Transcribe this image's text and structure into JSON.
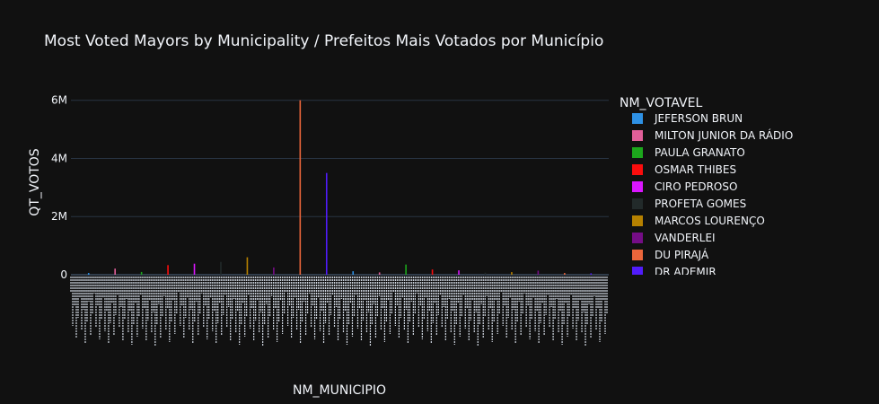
{
  "chart_data": {
    "type": "bar",
    "title": "Most Voted Mayors by Municipality / Prefeitos Mais Votados por Município",
    "xlabel": "NM_MUNICIPIO",
    "ylabel": "QT_VOTOS",
    "ylim": [
      0,
      6300000
    ],
    "yticks": [
      {
        "value": 0,
        "label": "0"
      },
      {
        "value": 2000000,
        "label": "2M"
      },
      {
        "value": 4000000,
        "label": "4M"
      },
      {
        "value": 6000000,
        "label": "6M"
      }
    ],
    "legend": {
      "title": "NM_VOTAVEL",
      "placement": "right",
      "items": [
        {
          "name": "JEFERSON BRUN",
          "color": "#2E91E5"
        },
        {
          "name": "MILTON JUNIOR DA RÁDIO",
          "color": "#E15F99"
        },
        {
          "name": "PAULA GRANATO",
          "color": "#1CA71C"
        },
        {
          "name": "OSMAR THIBES",
          "color": "#FB0D0D"
        },
        {
          "name": "CIRO PEDROSO",
          "color": "#DA16FF"
        },
        {
          "name": "PROFETA GOMES",
          "color": "#222A2A"
        },
        {
          "name": "MARCOS LOURENÇO",
          "color": "#B68100"
        },
        {
          "name": "VANDERLEI",
          "color": "#750D86"
        },
        {
          "name": "DU PIRAJÁ",
          "color": "#EB663B"
        },
        {
          "name": "DR ADEMIR",
          "color": "#511CFB"
        }
      ]
    },
    "series": [
      {
        "values": [
          60000,
          210000,
          95000,
          330000,
          380000,
          440000,
          600000,
          250000,
          6000000,
          3500000,
          120000,
          80000,
          350000,
          180000,
          150000,
          70000,
          90000,
          140000,
          60000,
          50000
        ],
        "color": "#2E91E5"
      }
    ],
    "colors": {
      "background": "#111111",
      "grid": "#283442",
      "text": "#f2f5fa"
    }
  }
}
